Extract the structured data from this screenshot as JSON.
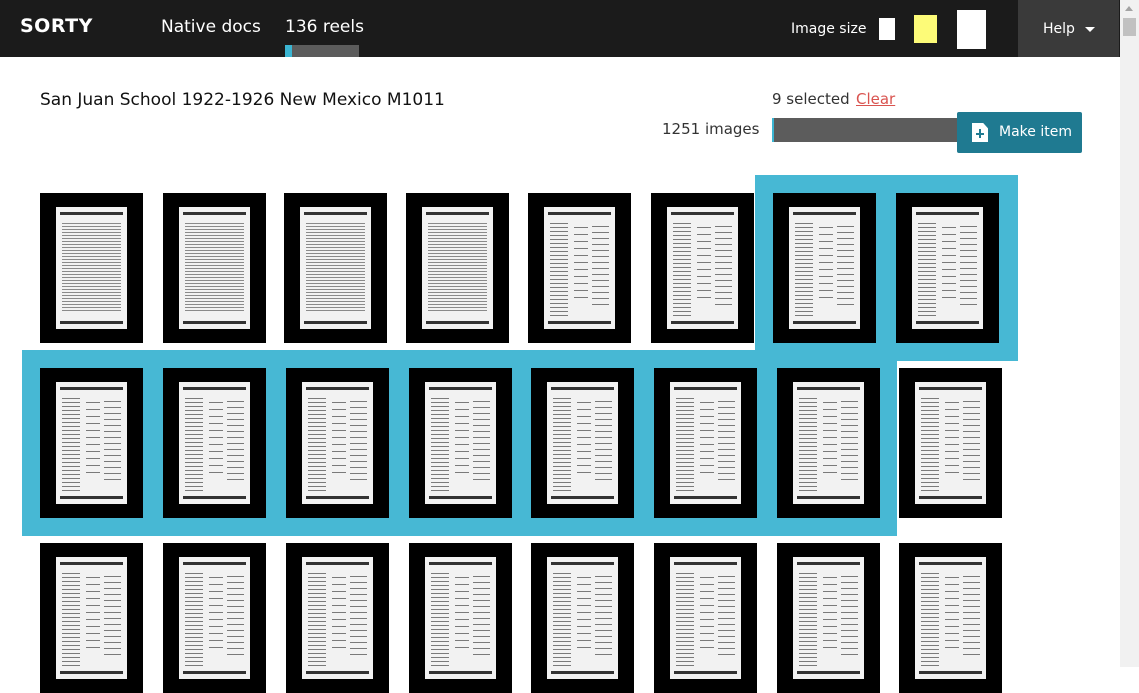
{
  "app": {
    "brand": "SORTY",
    "nav": {
      "native_docs": "Native docs",
      "reels": "136 reels"
    },
    "reels_progress_fraction": 0.1,
    "image_size_label": "Image size",
    "image_size_options": [
      "small",
      "medium",
      "large"
    ],
    "image_size_selected": "medium",
    "help_label": "Help"
  },
  "main": {
    "title": "San Juan School 1922-1926 New Mexico M1011",
    "selected_text": "9 selected",
    "clear_label": "Clear",
    "images_text": "1251 images",
    "sorted_fraction": 0.01,
    "make_item_label": "Make item",
    "make_item_icon": "file-plus-icon"
  },
  "colors": {
    "nav_bg": "#1b1b1b",
    "accent": "#3bb5d2",
    "selection": "#47b8d4",
    "button": "#1f7a91",
    "clear_link": "#d9534f",
    "size_highlight": "#fdfb78"
  },
  "thumbnails": [
    {
      "kind": "prose",
      "selected": false
    },
    {
      "kind": "prose",
      "selected": false
    },
    {
      "kind": "prose",
      "selected": false
    },
    {
      "kind": "prose",
      "selected": false
    },
    {
      "kind": "list",
      "selected": false
    },
    {
      "kind": "list",
      "selected": false
    },
    {
      "kind": "list",
      "selected": true
    },
    {
      "kind": "list",
      "selected": true
    },
    {
      "kind": "list",
      "selected": true
    },
    {
      "kind": "list",
      "selected": true
    },
    {
      "kind": "list",
      "selected": true
    },
    {
      "kind": "list",
      "selected": true
    },
    {
      "kind": "list",
      "selected": true
    },
    {
      "kind": "list",
      "selected": true
    },
    {
      "kind": "list",
      "selected": true
    },
    {
      "kind": "list",
      "selected": false
    },
    {
      "kind": "list",
      "selected": false
    },
    {
      "kind": "list",
      "selected": false
    },
    {
      "kind": "list",
      "selected": false
    },
    {
      "kind": "list",
      "selected": false
    },
    {
      "kind": "list",
      "selected": false
    },
    {
      "kind": "list",
      "selected": false
    },
    {
      "kind": "list",
      "selected": false
    },
    {
      "kind": "list",
      "selected": false
    }
  ]
}
